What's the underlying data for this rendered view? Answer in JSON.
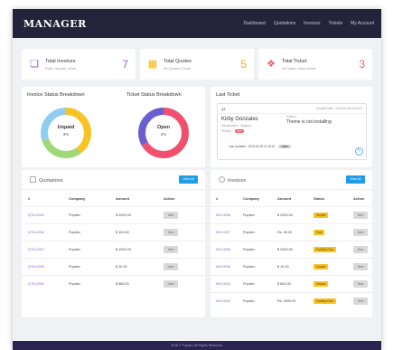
{
  "brand": "MANAGER",
  "nav": [
    "Dashboard",
    "Quotations",
    "Invoices",
    "Tickets",
    "My Account"
  ],
  "stats": [
    {
      "title": "Total Invoices",
      "subtitle": "Paid, Unpaid, other",
      "value": "7",
      "icon": "invoice-icon",
      "color": "#8a63c9"
    },
    {
      "title": "Total Quotes",
      "subtitle": "All Quotes Count",
      "value": "5",
      "icon": "quote-icon",
      "color": "#f4b400"
    },
    {
      "title": "Total Ticket",
      "subtitle": "All Open, close ticket",
      "value": "3",
      "icon": "ticket-icon",
      "color": "#f06262"
    }
  ],
  "invoice_status": {
    "title": "Invoice Status Breakdown",
    "label": "Unpaid",
    "value": "3%"
  },
  "ticket_status": {
    "title": "Ticket Status Breakdown",
    "label": "Open",
    "value": "2%"
  },
  "last_ticket": {
    "title": "Last Ticket",
    "id": "#3",
    "created": "Created Date : 2018-03-08 12:19:31",
    "name": "Kirby Gonzales",
    "department": "Department : Support",
    "priority_label": "Priority :",
    "priority": "High",
    "subject_label": "Subject",
    "subject": "Theme is not installing",
    "updated": "Last Updated : 2018-03-08 12:19:31",
    "status": "Open"
  },
  "quotations": {
    "title": "Quotations",
    "view_all": "View All",
    "headers": [
      "#",
      "Company",
      "Amount",
      "Action"
    ],
    "rows": [
      {
        "id": "QTN-0005",
        "company": "Popdev",
        "amount": "$ 2000.00",
        "action": "View"
      },
      {
        "id": "QTN-0008",
        "company": "Popdev",
        "amount": "$ 100.00",
        "action": "View"
      },
      {
        "id": "QTN-0007",
        "company": "Popdev",
        "amount": "$ 1000.00",
        "action": "View"
      },
      {
        "id": "QTN-0006",
        "company": "Popdev",
        "amount": "$ 10.00",
        "action": "View"
      },
      {
        "id": "QTN-0006",
        "company": "Popdev",
        "amount": "$ 580.00",
        "action": "View"
      }
    ]
  },
  "invoices": {
    "title": "Invoices",
    "view_all": "View All",
    "headers": [
      "#",
      "Company",
      "Amount",
      "Status",
      "Action"
    ],
    "rows": [
      {
        "id": "INV-0008",
        "company": "Popdev",
        "amount": "$ 2000.00",
        "status": "Unpaid",
        "action": "View"
      },
      {
        "id": "INV-0007",
        "company": "Popdev",
        "amount": "Rs. 50.00",
        "status": "Paid",
        "action": "View"
      },
      {
        "id": "INV-0006",
        "company": "Popdev",
        "amount": "$ 2000.00",
        "status": "Partially Paid",
        "action": "View"
      },
      {
        "id": "INV-0005",
        "company": "Popdev",
        "amount": "$ 10.00",
        "status": "Unpaid",
        "action": "View"
      },
      {
        "id": "INV-0004",
        "company": "Popdev",
        "amount": "$ 600.00",
        "status": "Unpaid",
        "action": "View"
      },
      {
        "id": "INV-0003",
        "company": "Popdev",
        "amount": "Rs. 3000.00",
        "status": "Partially Paid",
        "action": "View"
      }
    ]
  },
  "footer": "2018 © Popdev. All Rights Reserved."
}
